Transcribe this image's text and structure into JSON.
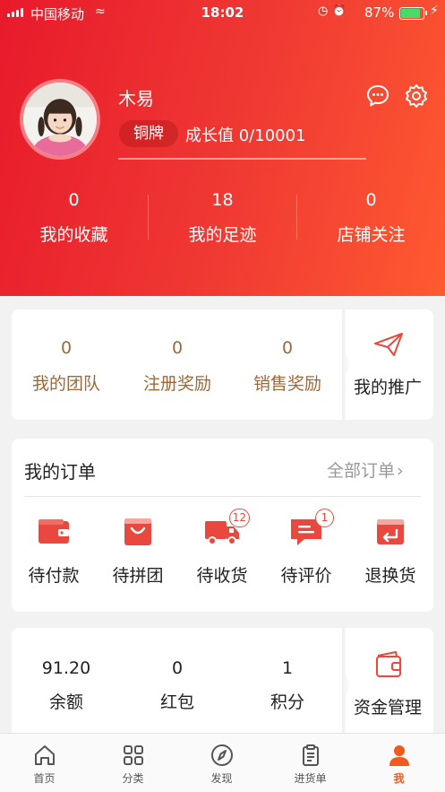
{
  "status_bar": {
    "carrier": "中国移动",
    "time": "18:02",
    "battery_percent": "87%",
    "battery_level": 0.87
  },
  "profile": {
    "username": "木易",
    "level_badge": "铜牌",
    "growth_text": "成长值 0/10001",
    "growth_progress": 0.0,
    "stats": [
      {
        "value": "0",
        "label": "我的收藏"
      },
      {
        "value": "18",
        "label": "我的足迹"
      },
      {
        "value": "0",
        "label": "店铺关注"
      }
    ]
  },
  "team": {
    "stats": [
      {
        "value": "0",
        "label": "我的团队"
      },
      {
        "value": "0",
        "label": "注册奖励"
      },
      {
        "value": "0",
        "label": "销售奖励"
      }
    ],
    "promo_label": "我的推广"
  },
  "orders": {
    "title": "我的订单",
    "all_label": "全部订单",
    "items": [
      {
        "label": "待付款",
        "icon": "wallet-icon",
        "badge": ""
      },
      {
        "label": "待拼团",
        "icon": "shopping-bag-icon",
        "badge": ""
      },
      {
        "label": "待收货",
        "icon": "truck-icon",
        "badge": "12"
      },
      {
        "label": "待评价",
        "icon": "review-icon",
        "badge": "1"
      },
      {
        "label": "退换货",
        "icon": "return-icon",
        "badge": ""
      }
    ]
  },
  "wallet": {
    "stats": [
      {
        "value": "91.20",
        "label": "余额"
      },
      {
        "value": "0",
        "label": "红包"
      },
      {
        "value": "1",
        "label": "积分"
      }
    ],
    "manage_label": "资金管理"
  },
  "tabbar": {
    "tabs": [
      {
        "label": "首页",
        "icon": "home-icon"
      },
      {
        "label": "分类",
        "icon": "category-icon"
      },
      {
        "label": "发现",
        "icon": "compass-icon"
      },
      {
        "label": "进货单",
        "icon": "clipboard-icon"
      },
      {
        "label": "我",
        "icon": "user-icon"
      }
    ],
    "active_index": 4
  },
  "colors": {
    "brand_red": "#e8483e",
    "accent_gold": "#9c6a3a",
    "active_tab": "#ef5a1f"
  }
}
